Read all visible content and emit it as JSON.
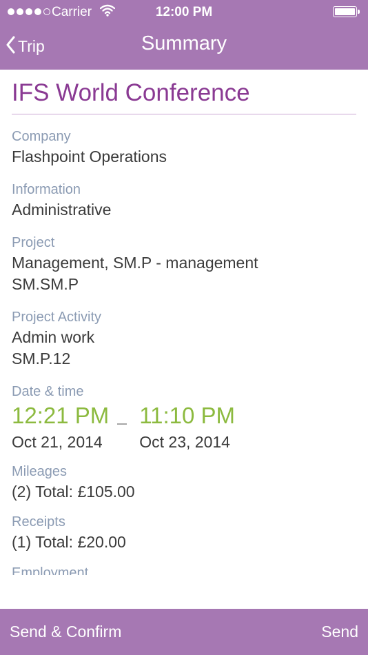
{
  "status_bar": {
    "carrier": "Carrier",
    "time": "12:00 PM",
    "signal_bars_filled": 4,
    "signal_bars_total": 5,
    "battery_level": 1.0
  },
  "nav": {
    "back_label": "Trip",
    "title": "Summary"
  },
  "trip": {
    "title": "IFS World Conference",
    "company_label": "Company",
    "company": "Flashpoint Operations",
    "information_label": "Information",
    "information": "Administrative",
    "project_label": "Project",
    "project_line1": "Management, SM.P - management",
    "project_line2": "SM.SM.P",
    "activity_label": "Project Activity",
    "activity_line1": "Admin work",
    "activity_line2": "SM.P.12",
    "datetime_label": "Date & time",
    "start_time": "12:21 PM",
    "start_date": "Oct 21, 2014",
    "end_time": "11:10 PM",
    "end_date": "Oct 23, 2014",
    "mileages_label": "Mileages",
    "mileages_value": "(2) Total: £105.00",
    "receipts_label": "Receipts",
    "receipts_value": "(1) Total: £20.00",
    "next_label": "Employment"
  },
  "footer": {
    "send_confirm_label": "Send & Confirm",
    "send_label": "Send"
  },
  "colors": {
    "bar": "#a678b3",
    "title": "#8a3a93",
    "label": "#8b9bb3",
    "time": "#8cba3f",
    "text": "#3b3b3b"
  },
  "icons": {
    "back": "chevron-left-icon",
    "wifi": "wifi-icon",
    "battery": "battery-icon"
  }
}
